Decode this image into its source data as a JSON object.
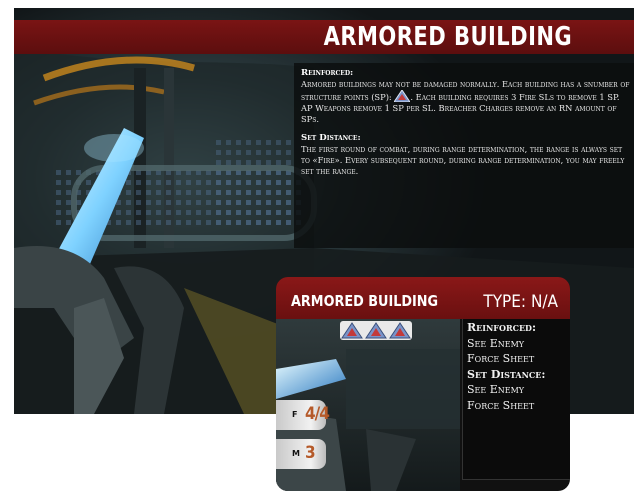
{
  "sheet": {
    "title": "ARMORED BUILDING",
    "reinforced_heading": "Reinforced:",
    "reinforced_text_a": "Armored buildings may not be damaged normally. Each building has a snumber of structure points (SP):",
    "sp_icon": "warning-triangle-icon",
    "reinforced_text_b": ". Each building requires 3 Fire SLs to remove 1 SP. AP Weapons remove 1 SP per SL. Breacher Charges remove an RN amount of SPs.",
    "set_distance_heading": "Set Distance:",
    "set_distance_text": "The first round of combat, during range determination, the range is always set to «Fire». Every subsequent round, during range determination, you may freely set the range."
  },
  "card": {
    "name": "ARMORED BUILDING",
    "type": "TYPE: N/A",
    "structure_points": 3,
    "reinforced_heading": "Reinforced:",
    "reinforced_line1": "See Enemy",
    "reinforced_line2": "Force Sheet",
    "set_distance_heading": "Set Distance:",
    "set_distance_line1": "See Enemy",
    "set_distance_line2": "Force Sheet",
    "stats": [
      {
        "label": "F",
        "value": "4/4"
      },
      {
        "label": "M",
        "value": "3"
      }
    ]
  },
  "colors": {
    "title_bar": "#6a1010",
    "stat_value": "#b55a2a",
    "sp_icon": "#7a93c8"
  }
}
